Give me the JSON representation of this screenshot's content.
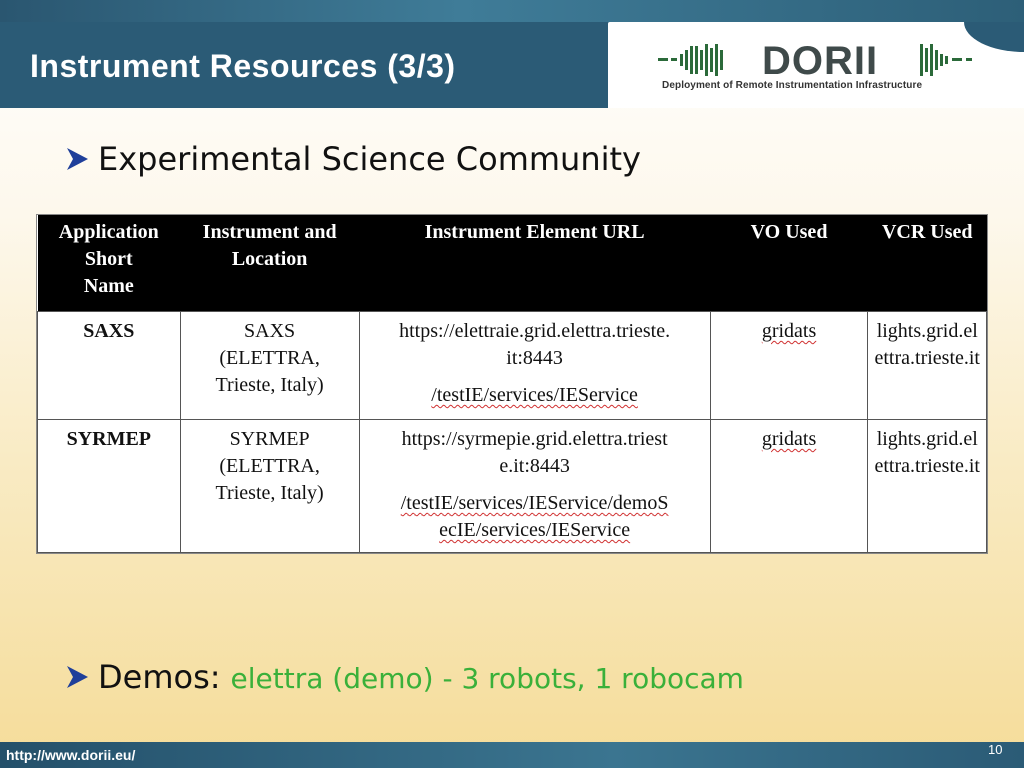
{
  "slide": {
    "title": "Instrument Resources (3/3)",
    "page_number": "10",
    "footer_url": "http://www.dorii.eu/"
  },
  "logo": {
    "text": "DORII",
    "subtitle": "Deployment of Remote Instrumentation Infrastructure"
  },
  "bullets": {
    "first": "Experimental Science Community",
    "second_label": "Demos:",
    "second_detail": "elettra (demo) - 3 robots, 1 robocam"
  },
  "table": {
    "headers": [
      [
        "Application",
        "Short",
        "Name"
      ],
      [
        "Instrument and",
        "Location"
      ],
      [
        "Instrument Element URL"
      ],
      [
        "VO Used"
      ],
      [
        "VCR Used"
      ]
    ],
    "rows": [
      {
        "name": "SAXS",
        "instrument": [
          "SAXS",
          "(ELETTRA,",
          "Trieste, Italy)"
        ],
        "url": [
          "https://elettraie.grid.elettra.trieste.",
          "it:8443",
          "/testIE/services/IEService"
        ],
        "vo": "gridats",
        "vcr": [
          "lights.grid.el",
          "ettra.trieste.it"
        ]
      },
      {
        "name": "SYRMEP",
        "instrument": [
          "SYRMEP",
          "(ELETTRA,",
          "Trieste, Italy)"
        ],
        "url": [
          "https://syrmepie.grid.elettra.triest",
          "e.it:8443",
          "/testIE/services/IEService/demoS",
          "ecIE/services/IEService"
        ],
        "vo": "gridats",
        "vcr": [
          "lights.grid.el",
          "ettra.trieste.it"
        ]
      }
    ]
  },
  "colors": {
    "header_band": "#2b5b76",
    "bullet_arrow": "#1f3f9a",
    "demo_green": "#3ab03a"
  },
  "icons": {
    "bullet": "arrow-bullet-icon"
  }
}
